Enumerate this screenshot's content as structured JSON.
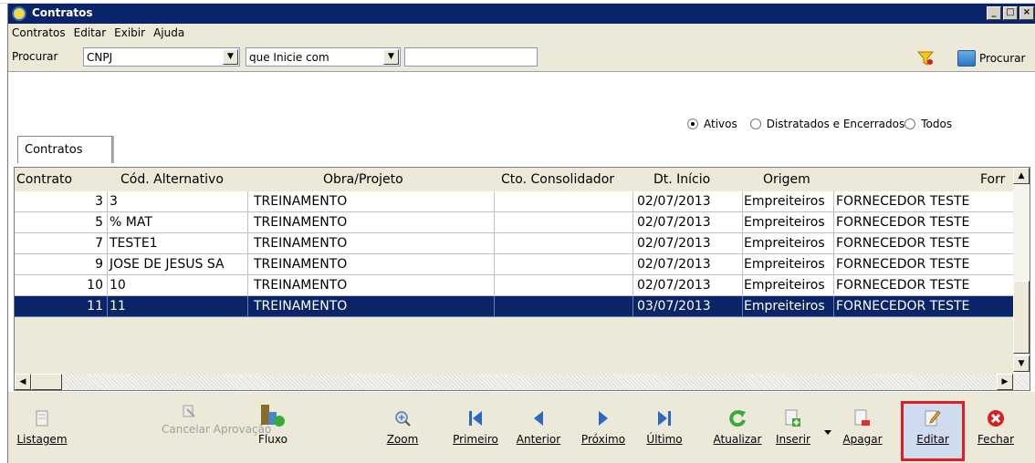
{
  "window": {
    "title": "Contratos",
    "buttons": [
      "_",
      "□",
      "×"
    ]
  },
  "menu": [
    "Contratos",
    "Editar",
    "Exibir",
    "Ajuda"
  ],
  "search": {
    "label": "Procurar",
    "field_value": "CNPJ",
    "operator_value": "que Inicie com",
    "text_value": "",
    "button_label": "Procurar"
  },
  "filter": {
    "options": [
      {
        "label": "Ativos",
        "selected": true
      },
      {
        "label": "Distratados e Encerrados",
        "selected": false
      },
      {
        "label": "Todos",
        "selected": false
      }
    ]
  },
  "tab": {
    "label": "Contratos"
  },
  "grid": {
    "columns": [
      "Contrato",
      "Cód. Alternativo",
      "Obra/Projeto",
      "Cto. Consolidador",
      "Dt. Início",
      "Origem",
      "Forr"
    ],
    "rows": [
      {
        "contrato": "3",
        "alt": "3",
        "obra": "TREINAMENTO",
        "cto": "",
        "dt": "02/07/2013",
        "origem": "Empreiteiros",
        "forn": "FORNECEDOR TESTE",
        "selected": false
      },
      {
        "contrato": "5",
        "alt": "% MAT",
        "obra": "TREINAMENTO",
        "cto": "",
        "dt": "02/07/2013",
        "origem": "Empreiteiros",
        "forn": "FORNECEDOR TESTE",
        "selected": false
      },
      {
        "contrato": "7",
        "alt": "TESTE1",
        "obra": "TREINAMENTO",
        "cto": "",
        "dt": "02/07/2013",
        "origem": "Empreiteiros",
        "forn": "FORNECEDOR TESTE",
        "selected": false
      },
      {
        "contrato": "9",
        "alt": "JOSE DE JESUS SA",
        "obra": "TREINAMENTO",
        "cto": "",
        "dt": "02/07/2013",
        "origem": "Empreiteiros",
        "forn": "FORNECEDOR TESTE",
        "selected": false
      },
      {
        "contrato": "10",
        "alt": "10",
        "obra": "TREINAMENTO",
        "cto": "",
        "dt": "02/07/2013",
        "origem": "Empreiteiros",
        "forn": "FORNECEDOR TESTE",
        "selected": false
      },
      {
        "contrato": "11",
        "alt": "11",
        "obra": "TREINAMENTO",
        "cto": "",
        "dt": "03/07/2013",
        "origem": "Empreiteiros",
        "forn": "FORNECEDOR TESTE",
        "selected": true
      }
    ]
  },
  "toolbar": {
    "listagem": "Listagem",
    "cancelar": "Cancelar Aprovação",
    "fluxo": "Fluxo",
    "zoom": "Zoom",
    "primeiro": "Primeiro",
    "anterior": "Anterior",
    "proximo": "Próximo",
    "ultimo": "Último",
    "atualizar": "Atualizar",
    "inserir": "Inserir",
    "apagar": "Apagar",
    "editar": "Editar",
    "fechar": "Fechar"
  },
  "colors": {
    "titlebar": "#0a246a",
    "selection": "#0a246a",
    "chrome": "#ece9d8",
    "highlight_border": "#e01c24"
  }
}
